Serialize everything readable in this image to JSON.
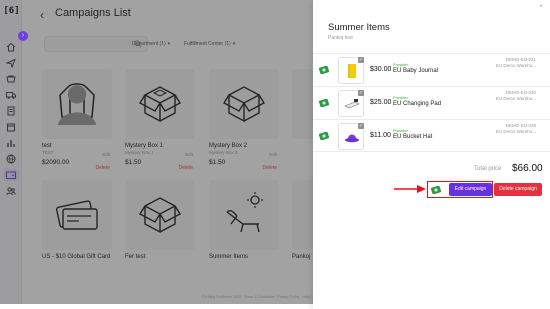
{
  "sidebar": {
    "logo": "[6]",
    "icons": [
      "home-icon",
      "send-icon",
      "shop-icon",
      "truck-icon",
      "document-icon",
      "box-icon",
      "chart-icon",
      "globe-icon",
      "wallet-icon",
      "team-icon"
    ],
    "collapse_glyph": "›"
  },
  "page": {
    "back_glyph": "‹",
    "title": "Campaigns List",
    "filters": [
      {
        "label": "Department (1)"
      },
      {
        "label": "Fulfillment Center (1)"
      }
    ],
    "cards": [
      {
        "name": "test",
        "sub": "TEST",
        "edit": "Edit",
        "price": "$2090.00",
        "delete": "Delete",
        "icon": "hoodie-icon"
      },
      {
        "name": "Mystery Box 1",
        "sub": "Mystery Box 1",
        "edit": "Edit",
        "price": "$1.50",
        "delete": "Delete",
        "icon": "box-icon"
      },
      {
        "name": "Mystery Box 2",
        "sub": "Mystery Box 2",
        "edit": "Edit",
        "price": "$1.50",
        "delete": "Delete",
        "icon": "box-icon"
      },
      {
        "name": "US - $10 Global Gift Card",
        "icon": "gift-card-icon"
      },
      {
        "name": "Fer test",
        "icon": "box-icon"
      },
      {
        "name": "Summer Items",
        "icon": "beach-chair-icon"
      },
      {
        "name": "Pankoj"
      }
    ],
    "footer": "© Kitting Fulfillment 2023 · Terms & Conditions · Privacy Policy · Help Center"
  },
  "panel": {
    "close": "×",
    "title": "Summer Items",
    "subtitle": "Pankoj test",
    "items": [
      {
        "price": "$30.00",
        "provider": "Provider",
        "name": "EU Baby Journal",
        "sku": "DEMO-EU-021",
        "warehouse": "EU Demo Wareho...",
        "color": "#f2cc0c",
        "icon": "journal-icon"
      },
      {
        "price": "$25.00",
        "provider": "Provider",
        "name": "EU Changing Pad",
        "sku": "DEMO-EU-030",
        "warehouse": "EU Demo Wareho...",
        "color": "#dcdcdc",
        "icon": "changing-pad-icon"
      },
      {
        "price": "$11.00",
        "provider": "Provider",
        "name": "EU Bucket Hat",
        "sku": "DEMO-EU-028",
        "warehouse": "EU Demo Wareho...",
        "color": "#7b3fe0",
        "icon": "bucket-hat-icon"
      }
    ],
    "total_label": "Total price",
    "total_value": "$66.00",
    "edit_label": "Edit campaign",
    "delete_label": "Delete campaign"
  },
  "colors": {
    "accent": "#6b2fe2",
    "danger": "#e03241",
    "provider_green": "#30a64a",
    "annotation_red": "#e3131b"
  }
}
